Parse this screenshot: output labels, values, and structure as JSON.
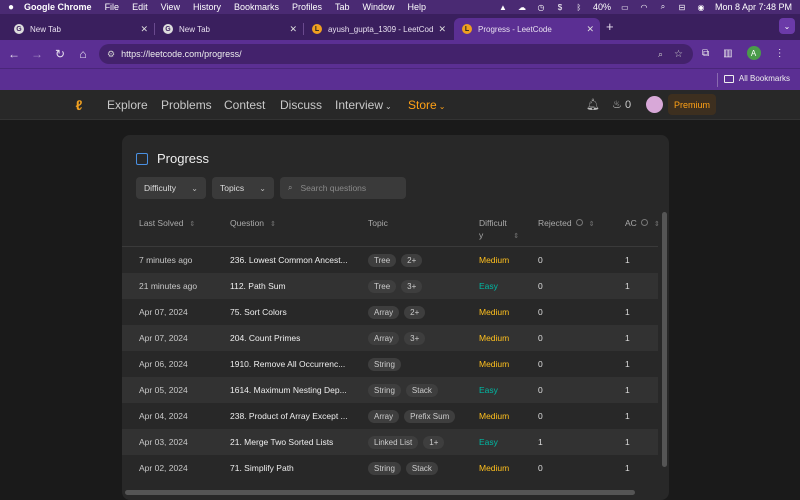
{
  "menubar": {
    "app": "Google Chrome",
    "items": [
      "File",
      "Edit",
      "View",
      "History",
      "Bookmarks",
      "Profiles",
      "Tab",
      "Window",
      "Help"
    ],
    "battery": "40%",
    "clock": "Mon 8 Apr  7:48 PM"
  },
  "tabs": [
    {
      "title": "New Tab",
      "icon": "chrome-icon"
    },
    {
      "title": "New Tab",
      "icon": "chrome-icon"
    },
    {
      "title": "ayush_gupta_1309 - LeetCod",
      "icon": "leetcode-icon"
    },
    {
      "title": "Progress - LeetCode",
      "icon": "leetcode-icon"
    }
  ],
  "address": {
    "url": "https://leetcode.com/progress/"
  },
  "bookmarks": {
    "all_label": "All Bookmarks"
  },
  "lcnav": {
    "items": [
      "Explore",
      "Problems",
      "Contest",
      "Discuss",
      "Interview",
      "Store"
    ],
    "streak": "0",
    "premium": "Premium"
  },
  "panel": {
    "title": "Progress",
    "filters": {
      "difficulty": "Difficulty",
      "topics": "Topics"
    },
    "search_placeholder": "Search questions",
    "columns": {
      "last_solved": "Last Solved",
      "question": "Question",
      "topic": "Topic",
      "difficulty_l1": "Difficult",
      "difficulty_l2": "y",
      "rejected": "Rejected",
      "ac": "AC"
    },
    "rows": [
      {
        "time": "7 minutes ago",
        "question": "236. Lowest Common Ancest...",
        "topics": [
          "Tree",
          "2+"
        ],
        "difficulty": "Medium",
        "rejected": "0",
        "ac": "1"
      },
      {
        "time": "21 minutes ago",
        "question": "112. Path Sum",
        "topics": [
          "Tree",
          "3+"
        ],
        "difficulty": "Easy",
        "rejected": "0",
        "ac": "1"
      },
      {
        "time": "Apr 07, 2024",
        "question": "75. Sort Colors",
        "topics": [
          "Array",
          "2+"
        ],
        "difficulty": "Medium",
        "rejected": "0",
        "ac": "1"
      },
      {
        "time": "Apr 07, 2024",
        "question": "204. Count Primes",
        "topics": [
          "Array",
          "3+"
        ],
        "difficulty": "Medium",
        "rejected": "0",
        "ac": "1"
      },
      {
        "time": "Apr 06, 2024",
        "question": "1910. Remove All Occurrenc...",
        "topics": [
          "String"
        ],
        "difficulty": "Medium",
        "rejected": "0",
        "ac": "1"
      },
      {
        "time": "Apr 05, 2024",
        "question": "1614. Maximum Nesting Dep...",
        "topics": [
          "String",
          "Stack"
        ],
        "difficulty": "Easy",
        "rejected": "0",
        "ac": "1"
      },
      {
        "time": "Apr 04, 2024",
        "question": "238. Product of Array Except ...",
        "topics": [
          "Array",
          "Prefix Sum"
        ],
        "difficulty": "Medium",
        "rejected": "0",
        "ac": "1"
      },
      {
        "time": "Apr 03, 2024",
        "question": "21. Merge Two Sorted Lists",
        "topics": [
          "Linked List",
          "1+"
        ],
        "difficulty": "Easy",
        "rejected": "1",
        "ac": "1"
      },
      {
        "time": "Apr 02, 2024",
        "question": "71. Simplify Path",
        "topics": [
          "String",
          "Stack"
        ],
        "difficulty": "Medium",
        "rejected": "0",
        "ac": "1"
      }
    ]
  },
  "colors": {
    "accent": "#ffa116",
    "medium": "#ffc01e",
    "easy": "#00b8a3",
    "chrome_frame": "#5b2f93"
  }
}
